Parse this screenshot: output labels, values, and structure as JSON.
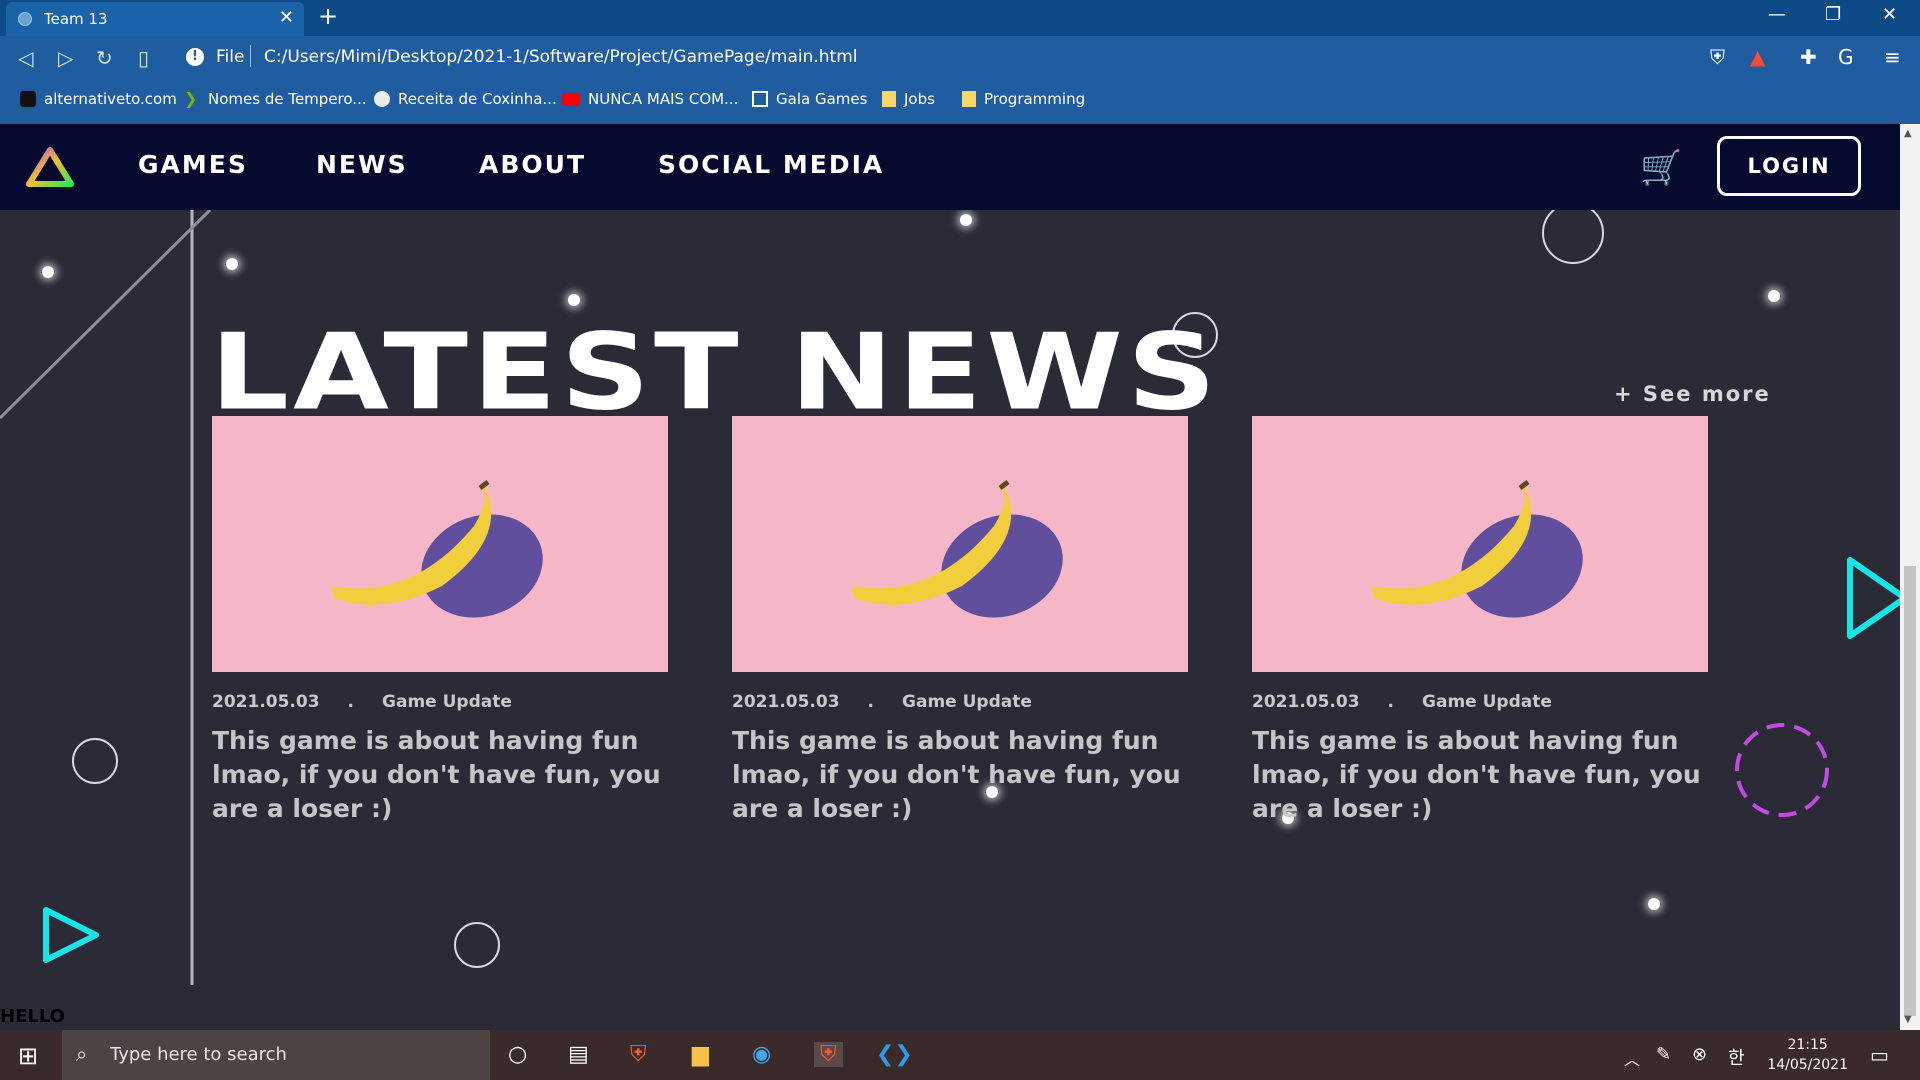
{
  "browser": {
    "tab_title": "Team 13",
    "tab_close": "✕",
    "new_tab": "+",
    "url_scheme": "File",
    "url": "C:/Users/Mimi/Desktop/2021-1/Software/Project/GamePage/main.html",
    "extension_badge": "1",
    "window_controls": {
      "minimize": "—",
      "restore": "❐",
      "close": "✕"
    }
  },
  "bookmarks": [
    {
      "label": "alternativeto.com",
      "icon": "alternativeto-icon",
      "color": "#1f1f1f"
    },
    {
      "label": "Nomes de Tempero...",
      "icon": "chevron-green-icon",
      "color": "#7ab800"
    },
    {
      "label": "Receita de Coxinha...",
      "icon": "chef-icon",
      "color": "#e8e8e8"
    },
    {
      "label": "NUNCA MAIS COM...",
      "icon": "youtube-icon",
      "color": "#ff0000"
    },
    {
      "label": "Gala Games",
      "icon": "cube-icon",
      "color": "#ffffff"
    },
    {
      "label": "Jobs",
      "icon": "folder-icon",
      "color": "#f6d76b"
    },
    {
      "label": "Programming",
      "icon": "folder-icon",
      "color": "#f6d76b"
    }
  ],
  "nav": {
    "links": [
      "GAMES",
      "NEWS",
      "ABOUT",
      "SOCIAL MEDIA"
    ],
    "login": "LOGIN"
  },
  "main": {
    "headline": "LATEST NEWS",
    "see_more": "+ See more",
    "cards": [
      {
        "date": "2021.05.03",
        "sep": ".",
        "category": "Game Update",
        "text": "This game is about having fun lmao, if you don't have fun, you are a loser :)"
      },
      {
        "date": "2021.05.03",
        "sep": ".",
        "category": "Game Update",
        "text": "This game is about having fun lmao, if you don't have fun, you are a loser :)"
      },
      {
        "date": "2021.05.03",
        "sep": ".",
        "category": "Game Update",
        "text": "This game is about having fun lmao, if you don't have fun, you are a loser :)"
      }
    ],
    "footer_text": "HELLO"
  },
  "taskbar": {
    "search_placeholder": "Type here to search",
    "time": "21:15",
    "date": "14/05/2021"
  },
  "colors": {
    "page_bg": "#2b2b38",
    "nav_bg": "#050a2e",
    "card_bg": "#f5b6c7",
    "accent_cyan": "#17e6e6",
    "accent_purple": "#c04ce0"
  }
}
